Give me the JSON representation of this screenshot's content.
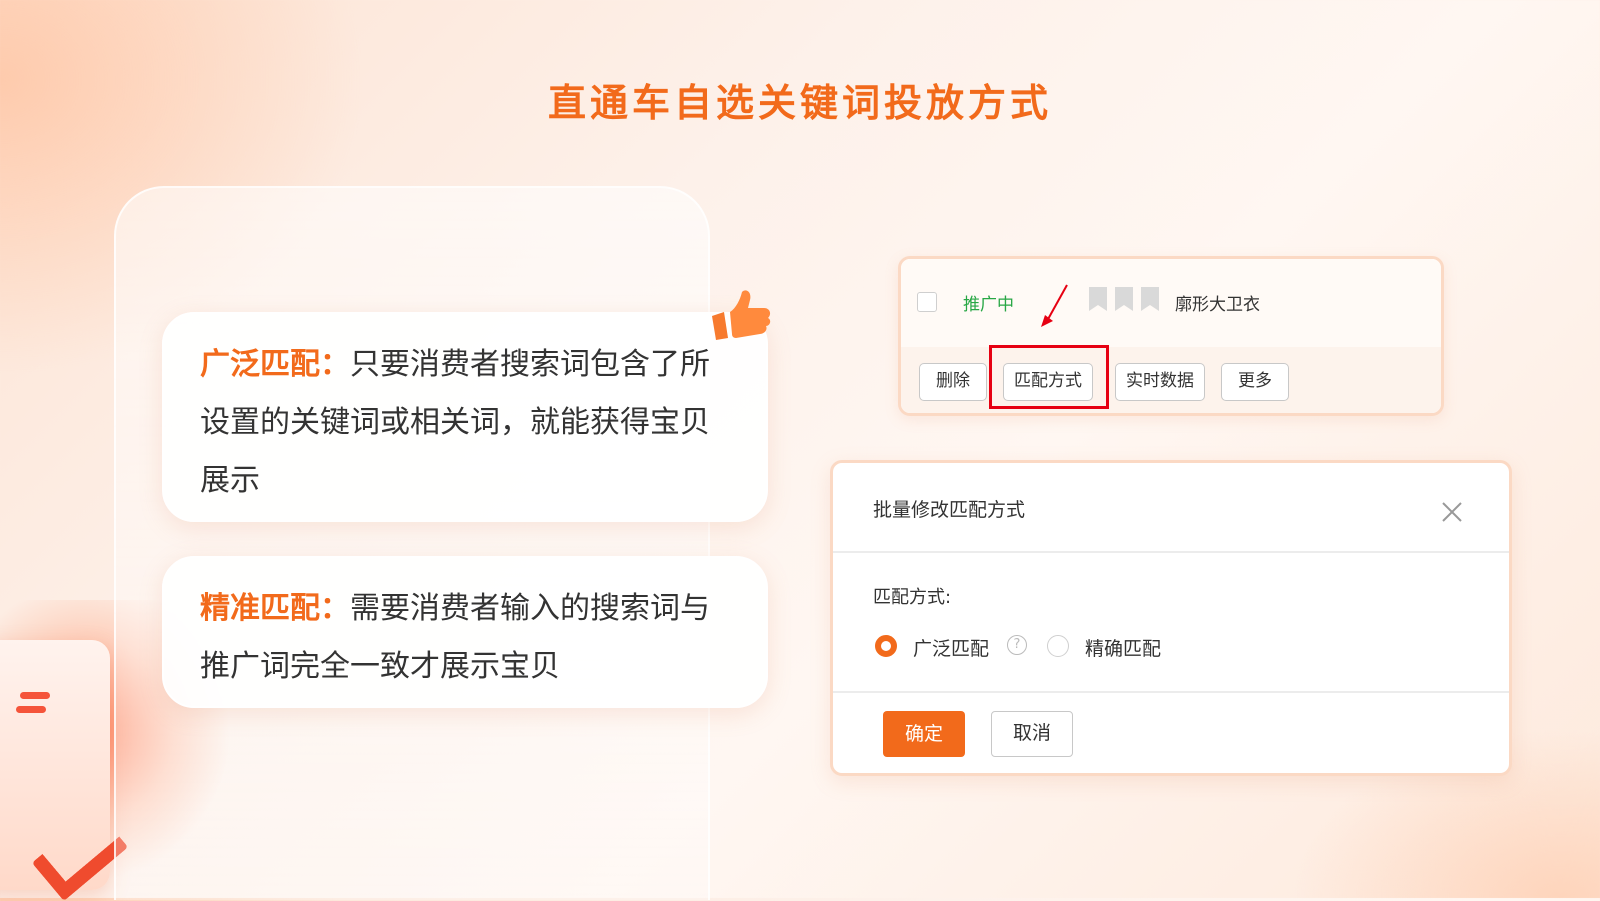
{
  "page": {
    "title": "直通车自选关键词投放方式"
  },
  "cards": {
    "broad": {
      "label": "广泛匹配：",
      "text": "只要消费者搜索词包含了所设置的关键词或相关词，就能获得宝贝展示"
    },
    "exact": {
      "label": "精准匹配：",
      "text": "需要消费者输入的搜索词与推广词完全一致才展示宝贝"
    }
  },
  "listing": {
    "status": "推广中",
    "product_name": "廓形大卫衣",
    "actions": {
      "delete": "删除",
      "match_type": "匹配方式",
      "realtime": "实时数据",
      "more": "更多"
    }
  },
  "dialog": {
    "title": "批量修改匹配方式",
    "field_label": "匹配方式:",
    "options": {
      "broad": "广泛匹配",
      "exact": "精确匹配"
    },
    "selected": "广泛匹配",
    "confirm": "确定",
    "cancel": "取消"
  },
  "colors": {
    "accent": "#f26a1b",
    "status_green": "#28a745",
    "highlight_red": "#e60012"
  },
  "icons": [
    "thumbs-up-icon",
    "checkbox-icon",
    "red-arrow-icon",
    "flag-icon",
    "close-icon",
    "help-icon",
    "radio-icon"
  ]
}
